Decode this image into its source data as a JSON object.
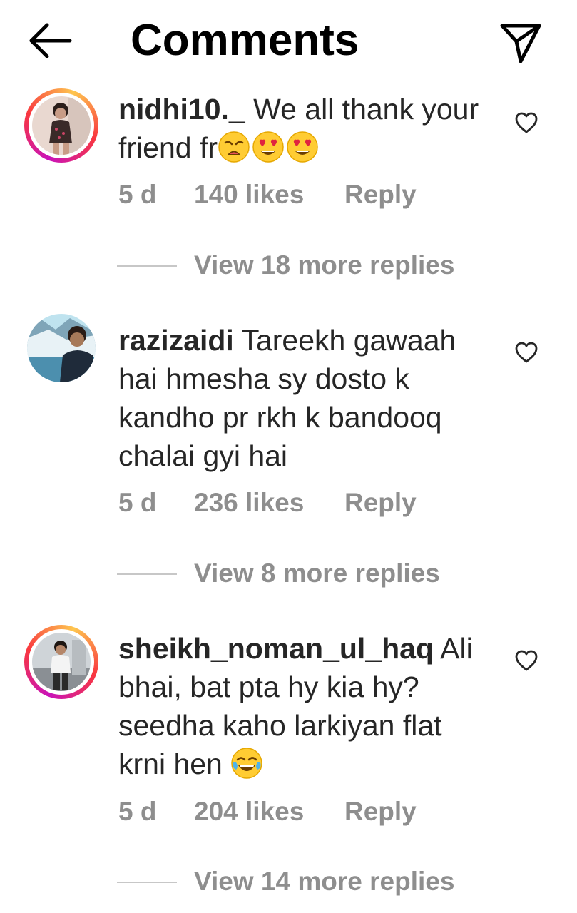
{
  "header": {
    "title": "Comments",
    "back_icon": "arrow-left-icon",
    "share_icon": "paper-plane-icon"
  },
  "colors": {
    "text": "#262626",
    "secondary": "#8e8e8e",
    "story_ring": [
      "#c913b9",
      "#f9373f",
      "#fec64f"
    ]
  },
  "comments": [
    {
      "username": "nidhi10._",
      "text": "We all thank your friend fr",
      "emojis": [
        "weary-face",
        "smiling-face-with-heart-eyes",
        "smiling-face-with-heart-eyes"
      ],
      "time": "5 d",
      "likes": "140 likes",
      "reply": "Reply",
      "view_replies": "View 18 more replies",
      "story_ring": true
    },
    {
      "username": "razizaidi",
      "text": "Tareekh gawaah hai hmesha sy dosto k kandho pr rkh k bandooq chalai gyi hai",
      "emojis": [],
      "time": "5 d",
      "likes": "236 likes",
      "reply": "Reply",
      "view_replies": "View 8 more replies",
      "story_ring": false
    },
    {
      "username": "sheikh_noman_ul_haq",
      "text": "Ali bhai, bat pta hy kia hy? seedha kaho larkiyan flat krni hen",
      "emojis": [
        "face-with-tears-of-joy"
      ],
      "time": "5 d",
      "likes": "204 likes",
      "reply": "Reply",
      "view_replies": "View 14 more replies",
      "story_ring": true
    }
  ]
}
